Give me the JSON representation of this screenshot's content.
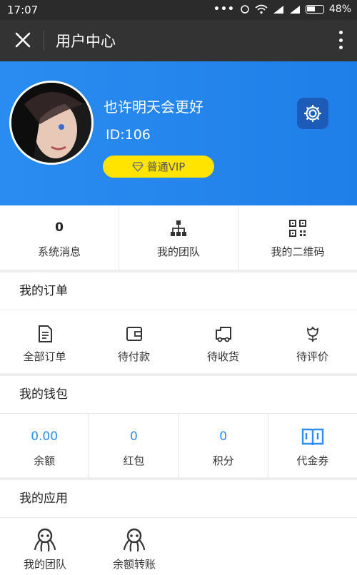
{
  "status_bar": {
    "time": "17:07",
    "dots": "•••",
    "battery": "48%"
  },
  "nav": {
    "title": "用户中心"
  },
  "profile": {
    "name": "也许明天会更好",
    "id": "ID:106",
    "level": "普通VIP"
  },
  "quick": {
    "messages": {
      "count": "0",
      "label": "系统消息"
    },
    "team": {
      "label": "我的团队"
    },
    "qrcode": {
      "label": "我的二维码"
    }
  },
  "orders": {
    "title": "我的订单",
    "items": [
      {
        "label": "全部订单",
        "icon": "document-icon"
      },
      {
        "label": "待付款",
        "icon": "wallet-icon"
      },
      {
        "label": "待收货",
        "icon": "truck-icon"
      },
      {
        "label": "待评价",
        "icon": "flower-icon"
      }
    ]
  },
  "wallet": {
    "title": "我的钱包",
    "items": [
      {
        "value": "0.00",
        "label": "余额"
      },
      {
        "value": "0",
        "label": "红包"
      },
      {
        "value": "0",
        "label": "积分"
      },
      {
        "label": "代金券",
        "icon": "coupon-book-icon"
      }
    ]
  },
  "apps": {
    "title": "我的应用",
    "items": [
      {
        "label": "我的团队",
        "icon": "octopus-icon"
      },
      {
        "label": "余额转账",
        "icon": "octopus-icon"
      }
    ]
  },
  "colors": {
    "header_blue": "#2a8cf0",
    "vip_yellow": "#ffe400",
    "settings_bg": "#1d5bb8",
    "value_blue": "#2c8ef0",
    "nav_dark": "#333333"
  }
}
